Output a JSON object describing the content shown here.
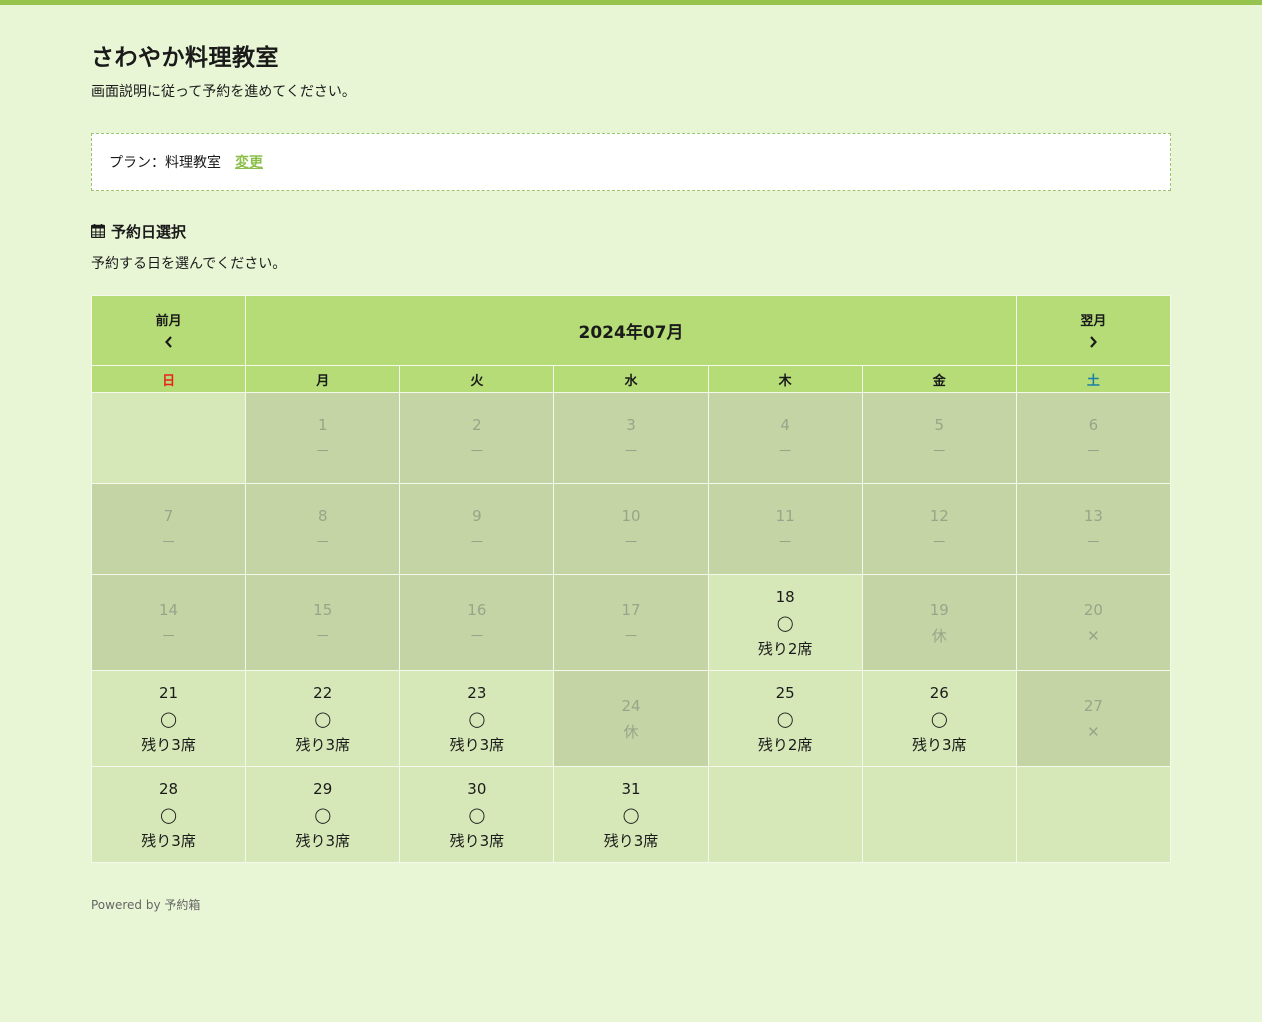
{
  "header": {
    "title": "さわやか料理教室",
    "subtitle": "画面説明に従って予約を進めてください。"
  },
  "plan": {
    "label": "プラン：料理教室",
    "change_label": "変更"
  },
  "section": {
    "title": "予約日選択",
    "description": "予約する日を選んでください。"
  },
  "calendar": {
    "prev_label": "前月",
    "prev_icon": "chevron-left-icon",
    "next_label": "翌月",
    "next_icon": "chevron-right-icon",
    "month_label": "2024年07月",
    "weekdays": [
      "日",
      "月",
      "火",
      "水",
      "木",
      "金",
      "土"
    ],
    "weeks": [
      [
        {
          "status": "empty"
        },
        {
          "day": "1",
          "mark": "－",
          "status": "disabled"
        },
        {
          "day": "2",
          "mark": "－",
          "status": "disabled"
        },
        {
          "day": "3",
          "mark": "－",
          "status": "disabled"
        },
        {
          "day": "4",
          "mark": "－",
          "status": "disabled"
        },
        {
          "day": "5",
          "mark": "－",
          "status": "disabled"
        },
        {
          "day": "6",
          "mark": "－",
          "status": "disabled"
        }
      ],
      [
        {
          "day": "7",
          "mark": "－",
          "status": "disabled"
        },
        {
          "day": "8",
          "mark": "－",
          "status": "disabled"
        },
        {
          "day": "9",
          "mark": "－",
          "status": "disabled"
        },
        {
          "day": "10",
          "mark": "－",
          "status": "disabled"
        },
        {
          "day": "11",
          "mark": "－",
          "status": "disabled"
        },
        {
          "day": "12",
          "mark": "－",
          "status": "disabled"
        },
        {
          "day": "13",
          "mark": "－",
          "status": "disabled"
        }
      ],
      [
        {
          "day": "14",
          "mark": "－",
          "status": "disabled"
        },
        {
          "day": "15",
          "mark": "－",
          "status": "disabled"
        },
        {
          "day": "16",
          "mark": "－",
          "status": "disabled"
        },
        {
          "day": "17",
          "mark": "－",
          "status": "disabled"
        },
        {
          "day": "18",
          "mark": "◯",
          "seats": "残り2席",
          "status": "available"
        },
        {
          "day": "19",
          "mark": "休",
          "status": "disabled"
        },
        {
          "day": "20",
          "mark": "✕",
          "status": "disabled"
        }
      ],
      [
        {
          "day": "21",
          "mark": "◯",
          "seats": "残り3席",
          "status": "available"
        },
        {
          "day": "22",
          "mark": "◯",
          "seats": "残り3席",
          "status": "available"
        },
        {
          "day": "23",
          "mark": "◯",
          "seats": "残り3席",
          "status": "available"
        },
        {
          "day": "24",
          "mark": "休",
          "status": "disabled"
        },
        {
          "day": "25",
          "mark": "◯",
          "seats": "残り2席",
          "status": "available"
        },
        {
          "day": "26",
          "mark": "◯",
          "seats": "残り3席",
          "status": "available"
        },
        {
          "day": "27",
          "mark": "✕",
          "status": "disabled"
        }
      ],
      [
        {
          "day": "28",
          "mark": "◯",
          "seats": "残り3席",
          "status": "available"
        },
        {
          "day": "29",
          "mark": "◯",
          "seats": "残り3席",
          "status": "available"
        },
        {
          "day": "30",
          "mark": "◯",
          "seats": "残り3席",
          "status": "available"
        },
        {
          "day": "31",
          "mark": "◯",
          "seats": "残り3席",
          "status": "available"
        },
        {
          "status": "empty"
        },
        {
          "status": "empty"
        },
        {
          "status": "empty"
        }
      ]
    ]
  },
  "footer": {
    "text": "Powered by 予約箱"
  },
  "colors": {
    "background": "#e9f6d6",
    "accent": "#96c24e",
    "header_cell": "#b5dc77",
    "available_cell": "#d7e8b8",
    "disabled_cell": "#c4d4a4",
    "sunday": "#e8231e",
    "saturday": "#1a7fa8"
  }
}
